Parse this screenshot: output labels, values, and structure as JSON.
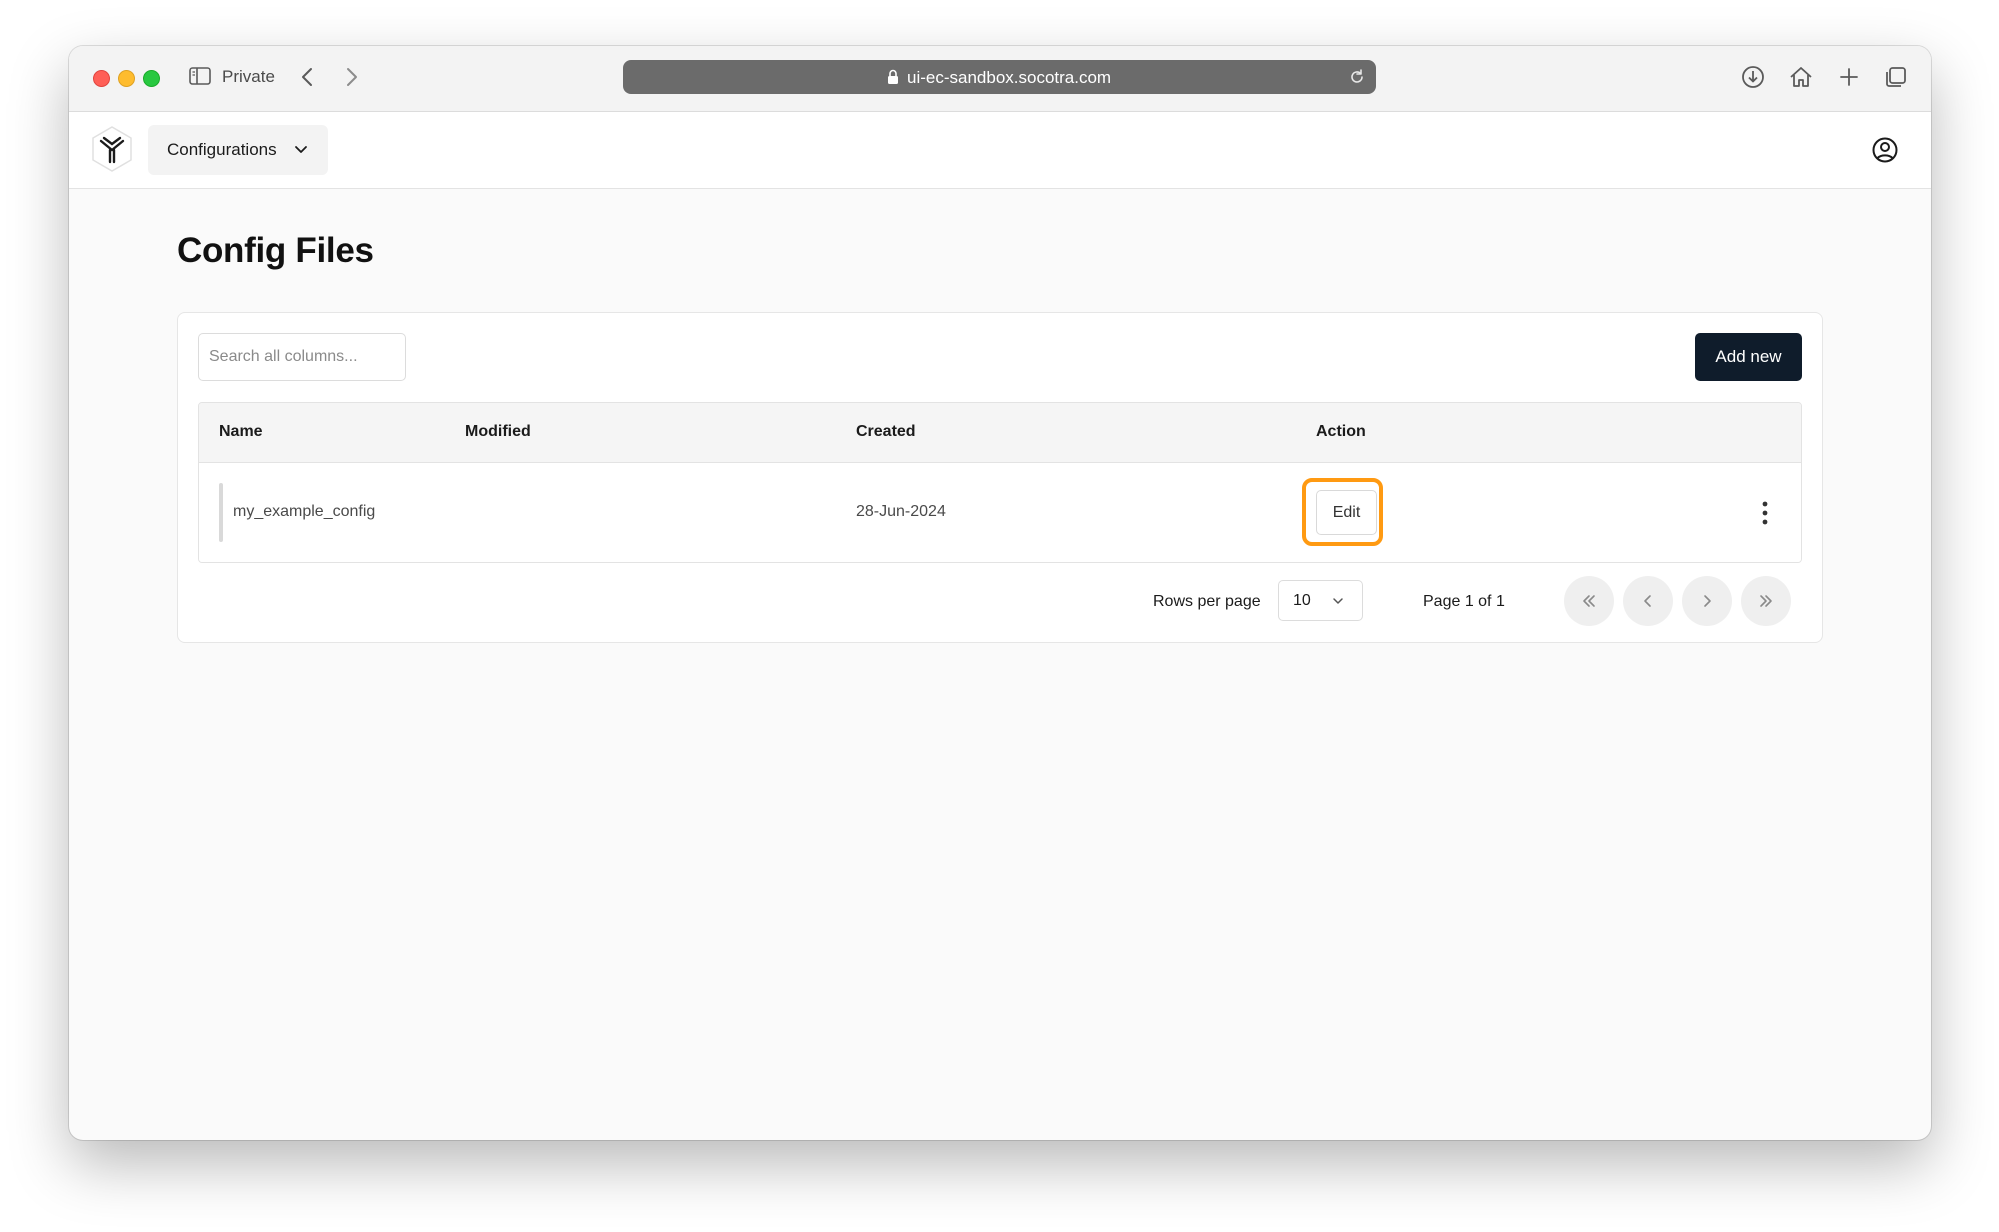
{
  "browser": {
    "private_label": "Private",
    "url": "ui-ec-sandbox.socotra.com"
  },
  "header": {
    "menu_label": "Configurations"
  },
  "page": {
    "title": "Config Files"
  },
  "toolbar": {
    "search_placeholder": "Search all columns...",
    "add_label": "Add new"
  },
  "table": {
    "columns": [
      "Name",
      "Modified",
      "Created",
      "Action"
    ],
    "rows": [
      {
        "name": "my_example_config",
        "modified": "",
        "created": "28-Jun-2024",
        "action": "Edit"
      }
    ]
  },
  "pagination": {
    "rows_per_page_label": "Rows per page",
    "rows_per_page_value": "10",
    "page_label": "Page 1 of 1"
  },
  "colors": {
    "primary_button": "#0f1c2b",
    "highlight": "#ff9a12"
  }
}
